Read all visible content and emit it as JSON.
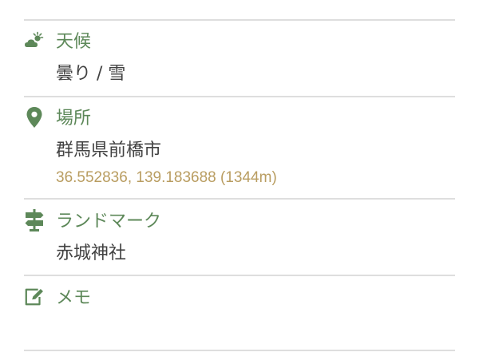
{
  "colors": {
    "accent": "#5d8859",
    "text": "#424242",
    "coords": "#b99d61",
    "divider": "#dedede"
  },
  "weather": {
    "icon": "partly-cloudy-icon",
    "label": "天候",
    "value": "曇り / 雪"
  },
  "location": {
    "icon": "map-pin-icon",
    "label": "場所",
    "value": "群馬県前橋市",
    "coords": "36.552836, 139.183688 (1344m)"
  },
  "landmark": {
    "icon": "signpost-icon",
    "label": "ランドマーク",
    "value": "赤城神社"
  },
  "memo": {
    "icon": "edit-note-icon",
    "label": "メモ",
    "value": ""
  }
}
